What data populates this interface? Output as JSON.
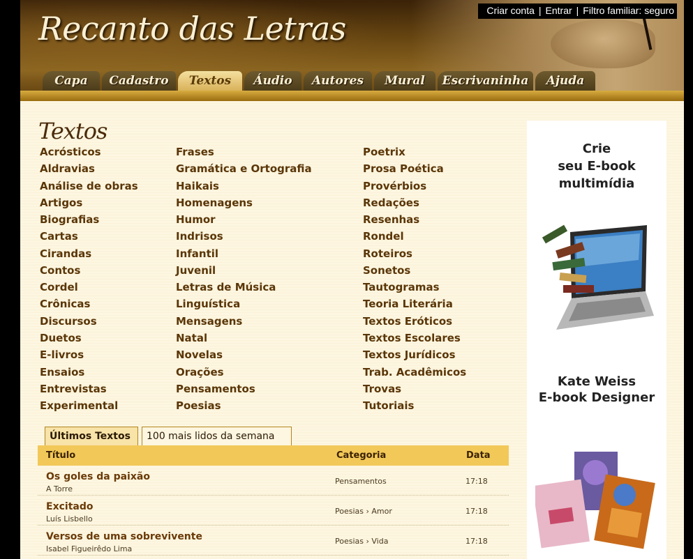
{
  "header": {
    "site_name": "Recanto das Letras",
    "top_links": {
      "create_account": "Criar conta",
      "sep1": "|",
      "login": "Entrar",
      "sep2": "|",
      "family_filter": "Filtro familiar: seguro"
    },
    "nav_tabs": [
      "Capa",
      "Cadastro",
      "Textos",
      "Áudio",
      "Autores",
      "Mural",
      "Escrivaninha",
      "Ajuda"
    ],
    "active_tab": "Textos"
  },
  "main": {
    "title": "Textos",
    "categories": {
      "col1": [
        "Acrósticos",
        "Aldravias",
        "Análise de obras",
        "Artigos",
        "Biografias",
        "Cartas",
        "Cirandas",
        "Contos",
        "Cordel",
        "Crônicas",
        "Discursos",
        "Duetos",
        "E-livros",
        "Ensaios",
        "Entrevistas",
        "Experimental"
      ],
      "col2": [
        "Frases",
        "Gramática e Ortografia",
        "Haikais",
        "Homenagens",
        "Humor",
        "Indrisos",
        "Infantil",
        "Juvenil",
        "Letras de Música",
        "Linguística",
        "Mensagens",
        "Natal",
        "Novelas",
        "Orações",
        "Pensamentos",
        "Poesias"
      ],
      "col3": [
        "Poetrix",
        "Prosa Poética",
        "Provérbios",
        "Redações",
        "Resenhas",
        "Rondel",
        "Roteiros",
        "Sonetos",
        "Tautogramas",
        "Teoria Literária",
        "Textos Eróticos",
        "Textos Escolares",
        "Textos Jurídicos",
        "Trab. Acadêmicos",
        "Trovas",
        "Tutoriais"
      ]
    },
    "list_tabs": [
      "Últimos Textos",
      "100 mais lidos da semana"
    ],
    "table": {
      "headers": {
        "title": "Título",
        "category": "Categoria",
        "date": "Data"
      },
      "rows": [
        {
          "title": "Os goles da paixão",
          "author": "A Torre",
          "category": "Pensamentos",
          "date": "17:18"
        },
        {
          "title": "Excitado",
          "author": "Luís Lisbello",
          "category": "Poesias › Amor",
          "date": "17:18"
        },
        {
          "title": "Versos de uma sobrevivente",
          "author": "Isabel Figueirêdo Lima",
          "category": "Poesias › Vida",
          "date": "17:18"
        }
      ]
    }
  },
  "ad": {
    "headline_1": "Crie",
    "headline_2": "seu E-book",
    "headline_3": "multimídia",
    "credit_1": "Kate Weiss",
    "credit_2": "E-book Designer"
  }
}
